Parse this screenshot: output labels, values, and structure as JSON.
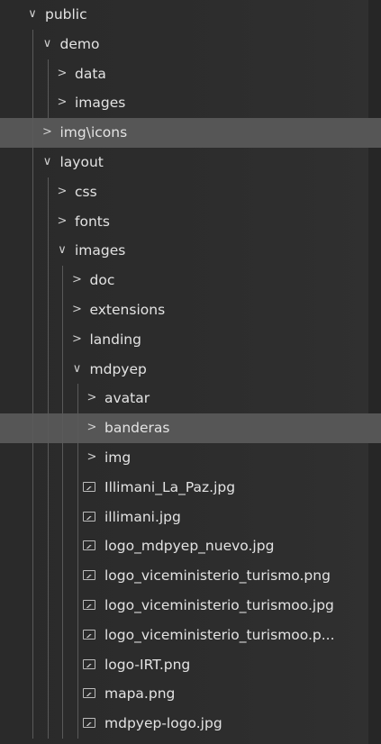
{
  "explorer": {
    "items": [
      {
        "label": "public",
        "type": "folder",
        "expanded": true,
        "depth": 0
      },
      {
        "label": "demo",
        "type": "folder",
        "expanded": true,
        "depth": 1
      },
      {
        "label": "data",
        "type": "folder",
        "expanded": false,
        "depth": 2
      },
      {
        "label": "images",
        "type": "folder",
        "expanded": false,
        "depth": 2
      },
      {
        "label": "img\\icons",
        "type": "folder",
        "expanded": false,
        "depth": 1,
        "highlighted": true
      },
      {
        "label": "layout",
        "type": "folder",
        "expanded": true,
        "depth": 1
      },
      {
        "label": "css",
        "type": "folder",
        "expanded": false,
        "depth": 2
      },
      {
        "label": "fonts",
        "type": "folder",
        "expanded": false,
        "depth": 2
      },
      {
        "label": "images",
        "type": "folder",
        "expanded": true,
        "depth": 2
      },
      {
        "label": "doc",
        "type": "folder",
        "expanded": false,
        "depth": 3
      },
      {
        "label": "extensions",
        "type": "folder",
        "expanded": false,
        "depth": 3
      },
      {
        "label": "landing",
        "type": "folder",
        "expanded": false,
        "depth": 3
      },
      {
        "label": "mdpyep",
        "type": "folder",
        "expanded": true,
        "depth": 3
      },
      {
        "label": "avatar",
        "type": "folder",
        "expanded": false,
        "depth": 4
      },
      {
        "label": "banderas",
        "type": "folder",
        "expanded": false,
        "depth": 4,
        "highlighted": true
      },
      {
        "label": "img",
        "type": "folder",
        "expanded": false,
        "depth": 4
      },
      {
        "label": "Illimani_La_Paz.jpg",
        "type": "image-file",
        "depth": 4
      },
      {
        "label": "illimani.jpg",
        "type": "image-file",
        "depth": 4
      },
      {
        "label": "logo_mdpyep_nuevo.jpg",
        "type": "image-file",
        "depth": 4
      },
      {
        "label": "logo_viceministerio_turismo.png",
        "type": "image-file",
        "depth": 4
      },
      {
        "label": "logo_viceministerio_turismoo.jpg",
        "type": "image-file",
        "depth": 4
      },
      {
        "label": "logo_viceministerio_turismoo.p...",
        "type": "image-file",
        "depth": 4
      },
      {
        "label": "logo-IRT.png",
        "type": "image-file",
        "depth": 4
      },
      {
        "label": "mapa.png",
        "type": "image-file",
        "depth": 4
      },
      {
        "label": "mdpyep-logo.jpg",
        "type": "image-file",
        "depth": 4
      }
    ]
  },
  "icons": {
    "expanded": "chevron-down-icon",
    "collapsed": "chevron-right-icon",
    "file": "image-file-icon"
  },
  "colors": {
    "background": "#2b2b2b",
    "highlight": "#565656",
    "text": "#e3e3e3"
  }
}
